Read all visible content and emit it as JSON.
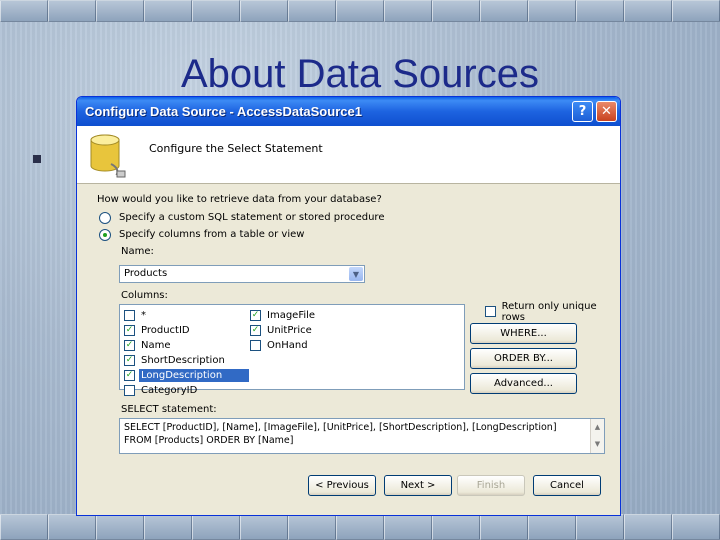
{
  "slide": {
    "title": "About Data Sources",
    "bullet": "▪"
  },
  "dialog": {
    "title": "Configure Data Source - AccessDataSource1",
    "help_icon": "?",
    "close_icon": "✕",
    "header_title": "Configure the Select Statement",
    "question": "How would you like to retrieve data from your database?",
    "options": [
      {
        "label": "Specify a custom SQL statement or stored procedure",
        "checked": false
      },
      {
        "label": "Specify columns from a table or view",
        "checked": true
      }
    ],
    "name_label": "Name:",
    "name_value": "Products",
    "columns_label": "Columns:",
    "columns": [
      {
        "label": "*",
        "checked": false,
        "selected": false
      },
      {
        "label": "ProductID",
        "checked": true,
        "selected": false
      },
      {
        "label": "Name",
        "checked": true,
        "selected": false
      },
      {
        "label": "ShortDescription",
        "checked": true,
        "selected": false
      },
      {
        "label": "LongDescription",
        "checked": true,
        "selected": true
      },
      {
        "label": "CategoryID",
        "checked": false,
        "selected": false
      },
      {
        "label": "ImageFile",
        "checked": true,
        "selected": false
      },
      {
        "label": "UnitPrice",
        "checked": true,
        "selected": false
      },
      {
        "label": "OnHand",
        "checked": false,
        "selected": false
      }
    ],
    "unique_rows_label": "Return only unique rows",
    "unique_rows_checked": false,
    "where_label": "WHERE...",
    "orderby_label": "ORDER BY...",
    "advanced_label": "Advanced...",
    "sql_label": "SELECT statement:",
    "sql_text": "SELECT [ProductID], [Name], [ImageFile], [UnitPrice], [ShortDescription], [LongDescription] FROM [Products] ORDER BY [Name]",
    "previous_label": "< Previous",
    "next_label": "Next >",
    "finish_label": "Finish",
    "cancel_label": "Cancel"
  },
  "colors": {
    "title_color": "#1c2a8a",
    "titlebar_blue": "#0e4fcf",
    "dialog_bg": "#ece9d8",
    "selection": "#316ac5"
  }
}
